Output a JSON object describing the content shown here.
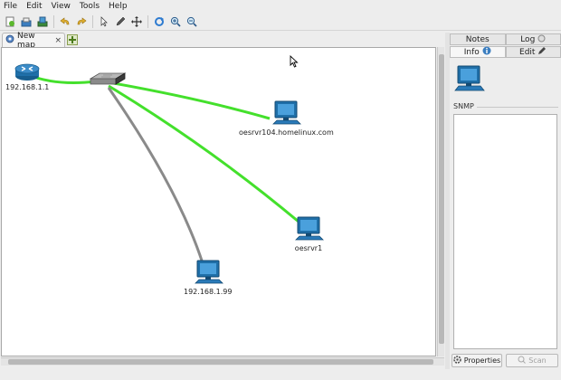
{
  "menu": [
    "File",
    "Edit",
    "View",
    "Tools",
    "Help"
  ],
  "toolbar": {
    "group1": [
      "new-map-icon",
      "open-map-icon",
      "save-map-icon"
    ],
    "group2": [
      "undo-icon",
      "redo-icon"
    ],
    "group3": [
      "pointer-icon",
      "pencil-icon",
      "move-icon"
    ],
    "group4": [
      "refresh-icon",
      "zoom-in-icon",
      "zoom-out-icon"
    ]
  },
  "tabs": {
    "map_tab": "New map",
    "close": "×"
  },
  "map": {
    "nodes": [
      {
        "id": "router",
        "label": "192.168.1.1",
        "type": "router"
      },
      {
        "id": "switch",
        "label": "",
        "type": "switch"
      },
      {
        "id": "host1",
        "label": "oesrvr104.homelinux.com",
        "type": "computer"
      },
      {
        "id": "host2",
        "label": "oesrvr1",
        "type": "computer"
      },
      {
        "id": "host3",
        "label": "192.168.1.99",
        "type": "computer"
      }
    ],
    "links": [
      {
        "from": "router",
        "to": "switch",
        "status": "up"
      },
      {
        "from": "switch",
        "to": "host1",
        "status": "up"
      },
      {
        "from": "switch",
        "to": "host2",
        "status": "up"
      },
      {
        "from": "switch",
        "to": "host3",
        "status": "unknown"
      }
    ]
  },
  "colors": {
    "link_up": "#44e02c",
    "link_unknown": "#8a8a8a",
    "device_blue": "#1f6fa8"
  },
  "panel": {
    "tabs_top": {
      "notes": "Notes",
      "log": "Log"
    },
    "tabs_bottom": {
      "info": "Info",
      "edit": "Edit"
    },
    "snmp_label": "SNMP",
    "properties_button": "Properties",
    "scan_button": "Scan"
  }
}
